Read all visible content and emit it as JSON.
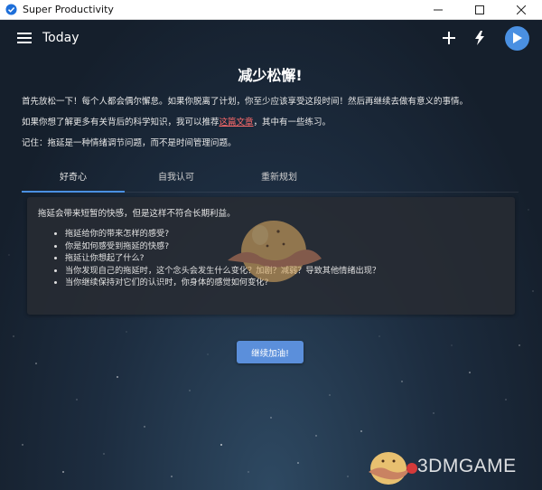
{
  "window": {
    "title": "Super Productivity"
  },
  "toolbar": {
    "title": "Today"
  },
  "procrastination": {
    "heading": "减少松懈!",
    "para1": "首先放松一下！每个人都会偶尔懈怠。如果你脱离了计划，你至少应该享受这段时间！然后再继续去做有意义的事情。",
    "para2_before": "如果你想了解更多有关背后的科学知识，我可以推荐",
    "para2_link": "这篇文章",
    "para2_after": "，其中有一些练习。",
    "para3": "记住：拖延是一种情绪调节问题，而不是时间管理问题。",
    "tabs": [
      {
        "label": "好奇心"
      },
      {
        "label": "自我认可"
      },
      {
        "label": "重新规划"
      }
    ],
    "card": {
      "lead": "拖延会带来短暂的快感，但是这样不符合长期利益。",
      "items": [
        "拖延给你的带来怎样的感受?",
        "你是如何感受到拖延的快感?",
        "拖延让你想起了什么?",
        "当你发现自己的拖延时，这个念头会发生什么变化？加剧？减弱？导致其他情绪出现？",
        "当你继续保持对它们的认识时，你身体的感觉如何变化?"
      ]
    },
    "continue_label": "继续加油!"
  },
  "watermark": {
    "text": "3DMGAME"
  },
  "colors": {
    "accent": "#4a90e2",
    "link": "#ff6b6b",
    "bg": "#1d2d40"
  }
}
